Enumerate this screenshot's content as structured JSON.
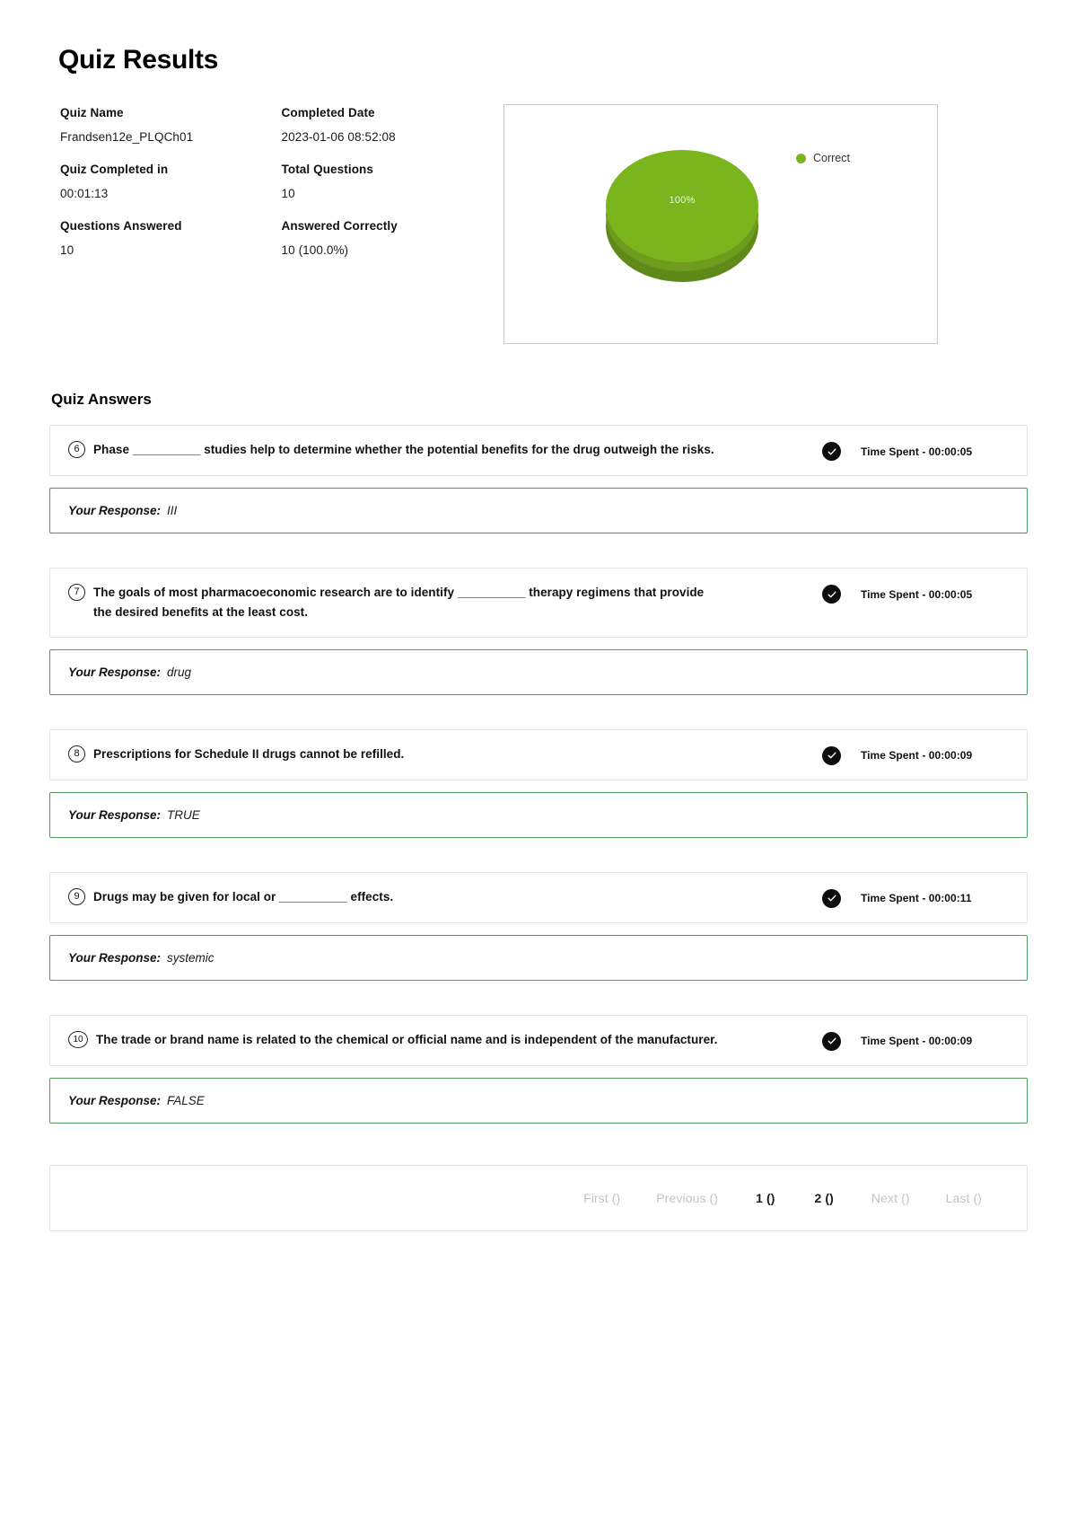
{
  "page_title": "Quiz Results",
  "summary": {
    "fields": [
      {
        "label": "Quiz Name",
        "value": "Frandsen12e_PLQCh01"
      },
      {
        "label": "Completed Date",
        "value": "2023-01-06 08:52:08"
      },
      {
        "label": "Quiz Completed in",
        "value": "00:01:13"
      },
      {
        "label": "Total Questions",
        "value": "10"
      },
      {
        "label": "Questions Answered",
        "value": "10"
      },
      {
        "label": "Answered Correctly",
        "value": "10 (100.0%)"
      }
    ]
  },
  "chart_data": {
    "type": "pie",
    "title": "",
    "categories": [
      "Correct"
    ],
    "values": [
      100
    ],
    "labels": [
      "100%"
    ],
    "colors": [
      "#7ab51d"
    ],
    "legend": [
      {
        "label": "Correct",
        "color": "#7ab51d"
      }
    ],
    "legend_position": "right",
    "three_d": true,
    "slice_label": "100%"
  },
  "answers_section": {
    "title": "Quiz Answers",
    "items": [
      {
        "number": "6",
        "question": "Phase __________ studies help to determine whether the potential benefits for the drug outweigh the risks.",
        "status_icon": "check-circle-icon",
        "time_spent": "Time Spent - 00:00:05",
        "response_label": "Your Response:",
        "response_value": "III"
      },
      {
        "number": "7",
        "question": "The goals of most pharmacoeconomic research are to identify __________ therapy regimens that provide the desired benefits at the least cost.",
        "status_icon": "check-circle-icon",
        "time_spent": "Time Spent - 00:00:05",
        "response_label": "Your Response:",
        "response_value": "drug"
      },
      {
        "number": "8",
        "question": "Prescriptions for Schedule II drugs cannot be refilled.",
        "status_icon": "check-circle-icon",
        "time_spent": "Time Spent - 00:00:09",
        "response_label": "Your Response:",
        "response_value": "TRUE"
      },
      {
        "number": "9",
        "question": "Drugs may be given for local or __________ effects.",
        "status_icon": "check-circle-icon",
        "time_spent": "Time Spent - 00:00:11",
        "response_label": "Your Response:",
        "response_value": "systemic"
      },
      {
        "number": "10",
        "question": "The trade or brand name is related to the chemical or official name and is independent of the manufacturer.",
        "status_icon": "check-circle-icon",
        "time_spent": "Time Spent - 00:00:09",
        "response_label": "Your Response:",
        "response_value": "FALSE"
      }
    ]
  },
  "pagination": {
    "first": "First ()",
    "previous": "Previous ()",
    "page_1": "1 ()",
    "page_2": "2 ()",
    "next": "Next ()",
    "last": "Last ()"
  }
}
